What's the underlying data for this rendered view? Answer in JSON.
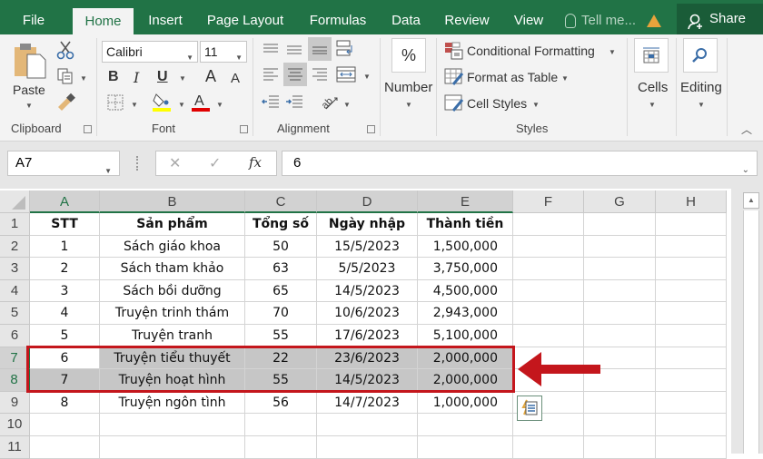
{
  "tabbar": {
    "tabs": [
      {
        "label": "File",
        "active": false
      },
      {
        "label": "Home",
        "active": true
      },
      {
        "label": "Insert",
        "active": false
      },
      {
        "label": "Page Layout",
        "active": false
      },
      {
        "label": "Formulas",
        "active": false
      },
      {
        "label": "Data",
        "active": false
      },
      {
        "label": "Review",
        "active": false
      },
      {
        "label": "View",
        "active": false
      }
    ],
    "tell_me": "Tell me...",
    "share": "Share"
  },
  "ribbon": {
    "clipboard": {
      "paste": "Paste",
      "label": "Clipboard"
    },
    "font": {
      "name": "Calibri",
      "size": "11",
      "label": "Font",
      "bold": "B",
      "italic": "I",
      "underline": "U",
      "grow": "A",
      "shrink": "A",
      "fill_color": "#ffff00",
      "font_color": "#e00000"
    },
    "alignment": {
      "label": "Alignment"
    },
    "number": {
      "label": "Number",
      "icon": "%"
    },
    "styles": {
      "conditional": "Conditional Formatting",
      "format_table": "Format as Table",
      "cell_styles": "Cell Styles",
      "label": "Styles"
    },
    "cells": {
      "label": "Cells"
    },
    "editing": {
      "label": "Editing"
    }
  },
  "formula_bar": {
    "name_box": "A7",
    "cancel": "✕",
    "enter": "✓",
    "fx": "fx",
    "value": "6"
  },
  "sheet": {
    "columns": [
      "A",
      "B",
      "C",
      "D",
      "E",
      "F",
      "G",
      "H"
    ],
    "row_numbers": [
      "1",
      "2",
      "3",
      "4",
      "5",
      "6",
      "7",
      "8",
      "9",
      "10",
      "11"
    ],
    "headers": [
      "STT",
      "Sản phẩm",
      "Tổng số",
      "Ngày nhập",
      "Thành tiền"
    ],
    "rows": [
      [
        "1",
        "Sách giáo khoa",
        "50",
        "15/5/2023",
        "1,500,000"
      ],
      [
        "2",
        "Sách tham khảo",
        "63",
        "5/5/2023",
        "3,750,000"
      ],
      [
        "3",
        "Sách bồi dưỡng",
        "65",
        "14/5/2023",
        "4,500,000"
      ],
      [
        "4",
        "Truyện trinh thám",
        "70",
        "10/6/2023",
        "2,943,000"
      ],
      [
        "5",
        "Truyện tranh",
        "55",
        "17/6/2023",
        "5,100,000"
      ],
      [
        "6",
        "Truyện tiểu thuyết",
        "22",
        "23/6/2023",
        "2,000,000"
      ],
      [
        "7",
        "Truyện hoạt hình",
        "55",
        "14/5/2023",
        "2,000,000"
      ],
      [
        "8",
        "Truyện ngôn tình",
        "56",
        "14/7/2023",
        "1,000,000"
      ]
    ],
    "selected_rows": [
      7,
      8
    ],
    "active_cell": "A7"
  },
  "annotation": {
    "color": "#c4161c"
  },
  "colors": {
    "brand": "#217346"
  }
}
